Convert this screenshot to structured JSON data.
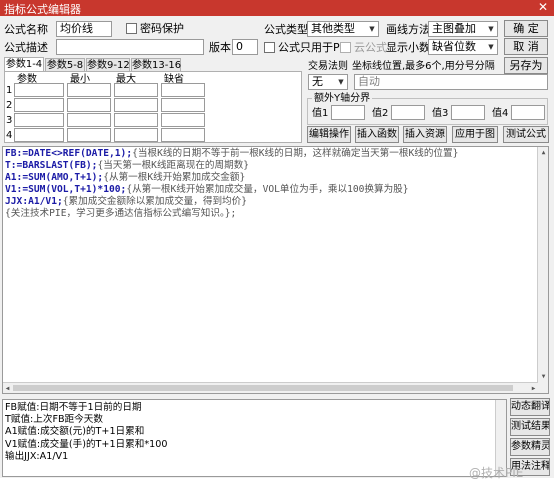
{
  "window": {
    "title": "指标公式编辑器",
    "close": "✕"
  },
  "form": {
    "name_label": "公式名称",
    "name_value": "均价线",
    "password_label": "密码保护",
    "desc_label": "公式描述",
    "desc_value": "",
    "version_label": "版本",
    "version_value": "0",
    "type_label": "公式类型",
    "type_value": "其他类型",
    "draw_label": "画线方法",
    "draw_value": "主图叠加",
    "pc_only_label": "公式只用于PC",
    "cloud_label": "云公式",
    "decimal_label": "显示小数",
    "decimal_value": "缺省位数"
  },
  "buttons": {
    "ok": "确  定",
    "cancel": "取  消",
    "save_as": "另存为",
    "edit_op": "编辑操作",
    "insert_func": "插入函数",
    "insert_res": "插入资源",
    "apply_chart": "应用于图",
    "test_formula": "测试公式"
  },
  "tabs": [
    "参数1-4",
    "参数5-8",
    "参数9-12",
    "参数13-16"
  ],
  "param_table": {
    "headers": [
      "参数",
      "最小",
      "最大",
      "缺省"
    ],
    "rows": [
      "1",
      "2",
      "3",
      "4"
    ]
  },
  "trade": {
    "label": "交易法则",
    "value": "无",
    "coord_label": "坐标线位置,最多6个,用分号分隔",
    "coord_value": "自动"
  },
  "extra_y": {
    "label": "额外Y轴分界",
    "values": [
      "值1",
      "值2",
      "值3",
      "值4"
    ]
  },
  "code": [
    [
      {
        "t": "FB:=",
        "k": "kw"
      },
      {
        "t": "DATE",
        "k": "kw"
      },
      {
        "t": "<>",
        "k": "kw"
      },
      {
        "t": "REF",
        "k": "kw"
      },
      {
        "t": "(",
        "k": "kw"
      },
      {
        "t": "DATE",
        "k": "kw"
      },
      {
        "t": ",1);",
        "k": "kw"
      },
      {
        "t": "{当根K线的日期不等于前一根K线的日期，这样就确定当天第一根K线的位置}",
        "k": "cm"
      }
    ],
    [
      {
        "t": "T:=",
        "k": "kw"
      },
      {
        "t": "BARSLAST",
        "k": "kw"
      },
      {
        "t": "(FB);",
        "k": "kw"
      },
      {
        "t": "{当天第一根K线距离现在的周期数}",
        "k": "cm"
      }
    ],
    [
      {
        "t": "A1:=",
        "k": "kw"
      },
      {
        "t": "SUM",
        "k": "kw"
      },
      {
        "t": "(",
        "k": "kw"
      },
      {
        "t": "AMO",
        "k": "kw"
      },
      {
        "t": ",T+1);",
        "k": "kw"
      },
      {
        "t": "{从第一根K线开始累加成交金额}",
        "k": "cm"
      }
    ],
    [
      {
        "t": "V1:=",
        "k": "kw"
      },
      {
        "t": "SUM",
        "k": "kw"
      },
      {
        "t": "(",
        "k": "kw"
      },
      {
        "t": "VOL",
        "k": "kw"
      },
      {
        "t": ",T+1)*100;",
        "k": "kw"
      },
      {
        "t": "{从第一根K线开始累加成交量，VOL单位为手，乘以100换算为股}",
        "k": "cm"
      }
    ],
    [
      {
        "t": "JJX:A1/V1;",
        "k": "kw"
      },
      {
        "t": "{累加成交金额除以累加成交量，得到均价}",
        "k": "cm"
      }
    ],
    [
      {
        "t": "{关注技术PIE，学习更多通达信指标公式编写知识。};",
        "k": "cm"
      }
    ]
  ],
  "output": [
    "FB赋值:日期不等于1日前的日期",
    "T赋值:上次FB距今天数",
    "A1赋值:成交额(元)的T+1日累和",
    "V1赋值:成交量(手)的T+1日累和*100",
    "输出JJX:A1/V1"
  ],
  "side_buttons": [
    "动态翻译",
    "测试结果",
    "参数精灵",
    "用法注释"
  ],
  "watermark": "@技术PIE"
}
